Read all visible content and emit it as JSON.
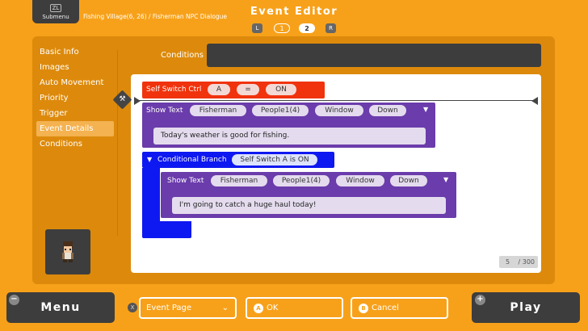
{
  "header": {
    "submenu_label": "Submenu",
    "submenu_key": "ZL",
    "breadcrumb": "Fishing Village(6, 26) / Fisherman NPC Dialogue",
    "title": "Event Editor",
    "pager_left_key": "L",
    "pager_right_key": "R",
    "pages": [
      "1",
      "2"
    ],
    "current_page": "2"
  },
  "sidebar": {
    "items": [
      {
        "label": "Basic Info"
      },
      {
        "label": "Images"
      },
      {
        "label": "Auto Movement"
      },
      {
        "label": "Priority"
      },
      {
        "label": "Trigger"
      },
      {
        "label": "Event Details",
        "active": true
      },
      {
        "label": "Conditions"
      }
    ]
  },
  "conditions": {
    "label": "Conditions",
    "value": ""
  },
  "commands": {
    "self_switch": {
      "label": "Self Switch Ctrl",
      "switch": "A",
      "operator": "=",
      "value": "ON"
    },
    "show_text_1": {
      "label": "Show Text",
      "name": "Fisherman",
      "face": "People1(4)",
      "background": "Window",
      "position": "Down",
      "message": "Today's weather is good for fishing."
    },
    "conditional_branch": {
      "label": "Conditional Branch",
      "condition": "Self Switch A is ON"
    },
    "show_text_2": {
      "label": "Show Text",
      "name": "Fisherman",
      "face": "People1(4)",
      "background": "Window",
      "position": "Down",
      "message": "I'm going to catch a huge haul today!"
    }
  },
  "counter": {
    "count": "5",
    "max": "/ 300"
  },
  "footer": {
    "menu_label": "Menu",
    "play_label": "Play",
    "menu_key": "−",
    "play_key": "+",
    "event_page_key": "X",
    "event_page_label": "Event Page",
    "ok_key": "A",
    "ok_label": "OK",
    "cancel_key": "B",
    "cancel_label": "Cancel"
  },
  "colors": {
    "background": "#f7a11a",
    "panel": "#dd8a0c",
    "self_switch_block": "#f0330d",
    "show_text_block": "#6b3cab",
    "conditional_block": "#0e18f0",
    "dark_button": "#3d3d3d"
  }
}
